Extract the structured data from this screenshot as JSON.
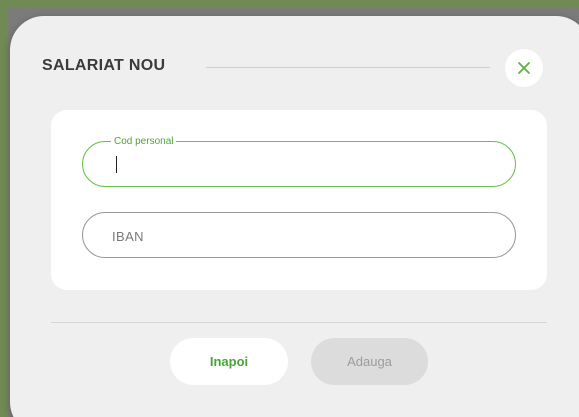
{
  "dialog": {
    "title": "SALARIAT NOU",
    "close_icon": "close-icon",
    "accent_color": "#6cc04a"
  },
  "form": {
    "cod_personal": {
      "label": "Cod personal",
      "value": ""
    },
    "iban": {
      "placeholder": "IBAN",
      "value": ""
    }
  },
  "footer": {
    "back_label": "Inapoi",
    "add_label": "Adauga"
  }
}
